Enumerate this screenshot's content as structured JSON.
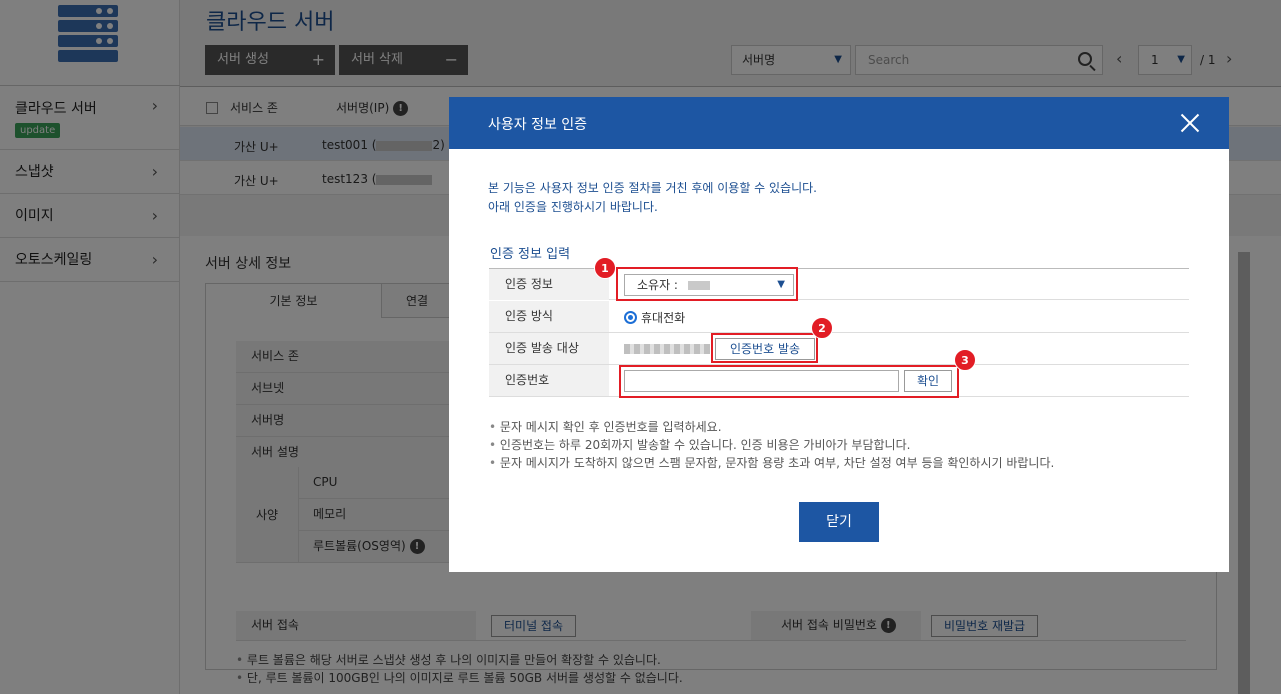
{
  "sidebar": {
    "items": [
      {
        "label": "클라우드 서버",
        "badge": "update"
      },
      {
        "label": "스냅샷"
      },
      {
        "label": "이미지"
      },
      {
        "label": "오토스케일링"
      }
    ]
  },
  "header": {
    "title": "클라우드 서버",
    "create_btn": "서버 생성",
    "delete_btn": "서버 삭제",
    "filter_select": "서버명",
    "search_placeholder": "Search",
    "page_current": "1",
    "page_total": "/ 1"
  },
  "list": {
    "columns": [
      "서비스 존",
      "서버명(IP)"
    ],
    "rows": [
      {
        "zone": "가산 U+",
        "name": "test001 (",
        "tail": "2)"
      },
      {
        "zone": "가산 U+",
        "name": "test123 ("
      }
    ]
  },
  "detail": {
    "title": "서버 상세 정보",
    "tabs": [
      "기본 정보",
      "연결"
    ],
    "fields": [
      "서비스 존",
      "서브넷",
      "서버명",
      "서버 설명"
    ],
    "spec_label": "사양",
    "spec_rows": [
      "CPU",
      "메모리",
      "루트볼륨(OS영역)"
    ],
    "access_label": "서버 접속",
    "terminal_btn": "터미널 접속",
    "access_pw_label": "서버 접속 비밀번호",
    "reset_pw_btn": "비밀번호 재발급",
    "notes": [
      "루트 볼륨은 해당 서버로 스냅샷 생성 후 나의 이미지를 만들어 확장할 수 있습니다.",
      "단, 루트 볼륨이 100GB인 나의 이미지로 루트 볼륨 50GB 서버를 생성할 수 없습니다."
    ]
  },
  "modal": {
    "title": "사용자 정보 인증",
    "intro": [
      "본 기능은 사용자 정보 인증 절차를 거친 후에 이용할 수 있습니다.",
      "아래 인증을 진행하시기 바랍니다."
    ],
    "section_title": "인증 정보 입력",
    "auth_info_label": "인증 정보",
    "auth_info_value": "소유자 :",
    "auth_method_label": "인증 방식",
    "auth_method_value": "휴대전화",
    "send_target_label": "인증 발송 대상",
    "send_code_btn": "인증번호 발송",
    "code_label": "인증번호",
    "confirm_btn": "확인",
    "notes": [
      "문자 메시지 확인 후 인증번호를 입력하세요.",
      "인증번호는 하루 20회까지 발송할 수 있습니다. 인증 비용은 가비아가 부담합니다.",
      "문자 메시지가 도착하지 않으면 스팸 문자함, 문자함 용량 초과 여부, 차단 설정 여부 등을 확인하시기 바랍니다."
    ],
    "close_btn": "닫기",
    "step_numbers": [
      "1",
      "2",
      "3"
    ]
  },
  "colors": {
    "brand_blue": "#1d56a3",
    "highlight_red": "#e21d25",
    "badge_green": "#3aa35a"
  }
}
